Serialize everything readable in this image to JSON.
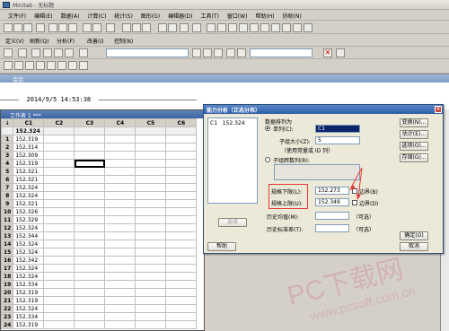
{
  "app": {
    "title": "Minitab - 无标题"
  },
  "menu": [
    "文件(F)",
    "编辑(E)",
    "数据(A)",
    "计算(C)",
    "统计(S)",
    "图形(G)",
    "编辑器(D)",
    "工具(T)",
    "窗口(W)",
    "帮助(H)",
    "协助(N)"
  ],
  "toolbar2": {
    "items": [
      "定义(V)",
      "刷新(Q)",
      "分析(F)",
      "改善(I)",
      "控制(N)"
    ]
  },
  "session": {
    "title": "会话",
    "timestamp": "—————  2014/9/5 14:53:38  ——————————————————————————"
  },
  "worksheet": {
    "title": "工作表 1 ***",
    "columns": [
      "C1",
      "C2",
      "C3",
      "C4",
      "C5",
      "C6"
    ],
    "c1_name": "152.324",
    "rows": [
      [
        "1",
        "152.319"
      ],
      [
        "2",
        "152.314"
      ],
      [
        "3",
        "152.309"
      ],
      [
        "4",
        "152.319"
      ],
      [
        "5",
        "152.321"
      ],
      [
        "6",
        "152.321"
      ],
      [
        "7",
        "152.324"
      ],
      [
        "8",
        "152.324"
      ],
      [
        "9",
        "152.321"
      ],
      [
        "10",
        "152.326"
      ],
      [
        "11",
        "152.329"
      ],
      [
        "12",
        "152.324"
      ],
      [
        "13",
        "152.344"
      ],
      [
        "14",
        "152.324"
      ],
      [
        "15",
        "152.324"
      ],
      [
        "16",
        "152.342"
      ],
      [
        "17",
        "152.324"
      ],
      [
        "18",
        "152.324"
      ],
      [
        "19",
        "152.334"
      ],
      [
        "20",
        "152.319"
      ],
      [
        "21",
        "152.319"
      ],
      [
        "22",
        "152.324"
      ],
      [
        "23",
        "152.334"
      ],
      [
        "24",
        "152.319"
      ]
    ]
  },
  "dialog": {
    "title": "能力分析（正态分布）",
    "list_item_col": "C1",
    "list_item_val": "152.324",
    "data_arrangement": "数据排列为",
    "single_column": "单列(C):",
    "single_value": "C1",
    "subgroup_size": "子组大小(Z):",
    "subgroup_value": "5",
    "subgroup_hint": "（使用常量或 ID 列）",
    "subgroup_across": "子组跨数列(R):",
    "lower_spec": "规格下限(L):",
    "lower_value": "152.273",
    "boundary": "边界(B)",
    "upper_spec": "规格上限(U):",
    "upper_value": "152.349",
    "boundary2": "边界(D)",
    "hist_mean": "历史均值(M):",
    "optional": "（可选）",
    "hist_std": "历史标准差(T):",
    "optional2": "（可选）",
    "select_btn": "选择",
    "help_btn": "帮助",
    "transform_btn": "变换(N)...",
    "estimate_btn": "估计(E)...",
    "options_btn": "选项(O)...",
    "storage_btn": "存储(G)...",
    "ok_btn": "确定(O)",
    "cancel_btn": "取消"
  },
  "watermark": {
    "big": "PC下载网",
    "url": "www.pcsoft.com.cn"
  },
  "colors": {
    "highlight_red": "#e23a3a"
  }
}
